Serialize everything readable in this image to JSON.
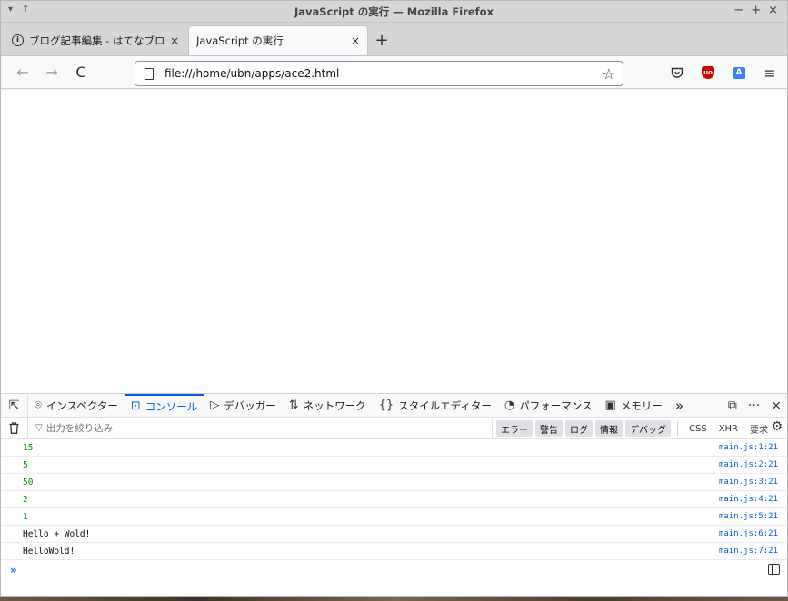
{
  "window": {
    "title": "JavaScript の実行 — Mozilla Firefox",
    "controls": {
      "minimize": "−",
      "maximize": "+",
      "close": "×"
    },
    "left_controls": {
      "menu": "▾",
      "pin": "↑"
    }
  },
  "tabs": [
    {
      "label": "ブログ記事編集 - はてなブログ",
      "close": "×",
      "favicon": "i"
    },
    {
      "label": "JavaScript の実行",
      "close": "×"
    }
  ],
  "new_tab": "+",
  "nav": {
    "back": "←",
    "forward": "→",
    "reload": "C",
    "url": "file:///home/ubn/apps/ace2.html",
    "star": "☆",
    "menu": "≡"
  },
  "devtools": {
    "pick": "⇱",
    "tabs": [
      {
        "icon": "⌾",
        "label": "インスペクター"
      },
      {
        "icon": "⊡",
        "label": "コンソール",
        "selected": true
      },
      {
        "icon": "▷",
        "label": "デバッガー"
      },
      {
        "icon": "⇅",
        "label": "ネットワーク"
      },
      {
        "icon": "{}",
        "label": "スタイルエディター"
      },
      {
        "icon": "◔",
        "label": "パフォーマンス"
      },
      {
        "icon": "▣",
        "label": "メモリー"
      }
    ],
    "more_tabs": "»",
    "right": {
      "dock": "⧉",
      "more": "···",
      "close": "×"
    }
  },
  "console": {
    "trash": "🗑",
    "filter_placeholder": "出力を絞り込み",
    "filter_buttons": [
      "エラー",
      "警告",
      "ログ",
      "情報",
      "デバッグ"
    ],
    "plain_buttons": [
      "CSS",
      "XHR",
      "要求"
    ],
    "settings": "⚙",
    "rows": [
      {
        "message": "15",
        "location": "main.js:1:21",
        "kind": "num"
      },
      {
        "message": "5",
        "location": "main.js:2:21",
        "kind": "num"
      },
      {
        "message": "50",
        "location": "main.js:3:21",
        "kind": "num"
      },
      {
        "message": "2",
        "location": "main.js:4:21",
        "kind": "num"
      },
      {
        "message": "1",
        "location": "main.js:5:21",
        "kind": "num"
      },
      {
        "message": "Hello + Wold!",
        "location": "main.js:6:21",
        "kind": "str"
      },
      {
        "message": "HelloWold!",
        "location": "main.js:7:21",
        "kind": "str"
      }
    ],
    "prompt": "»"
  }
}
